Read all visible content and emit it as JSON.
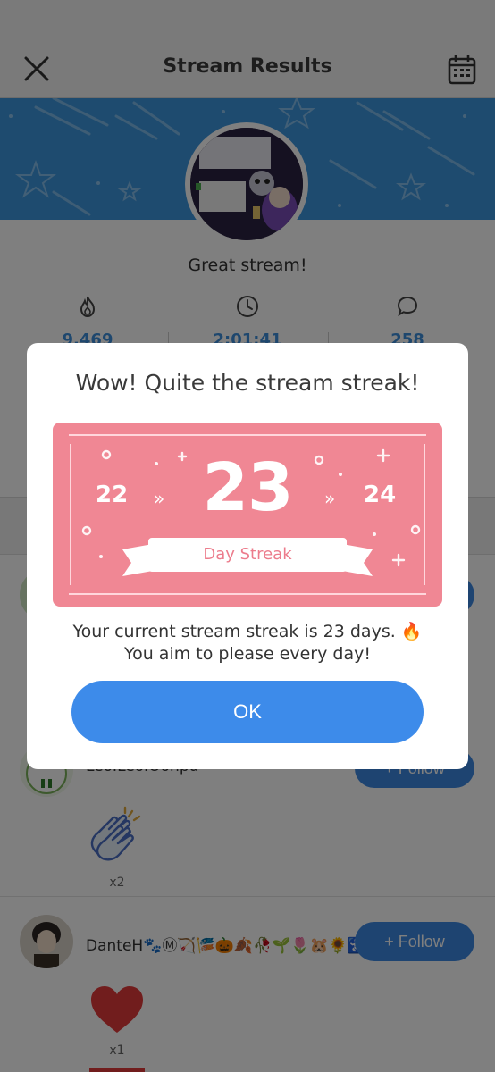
{
  "header": {
    "title": "Stream Results",
    "close_icon": "close-icon",
    "calendar_icon": "calendar-icon"
  },
  "banner": {
    "color": "#3d97de",
    "avatar_texts": [
      "scary sundays",
      "the witches house",
      "lurk ok!",
      "newcomer ok!"
    ]
  },
  "summary": {
    "headline": "Great stream!",
    "stats": [
      {
        "icon": "flame-icon",
        "value": "9,469"
      },
      {
        "icon": "clock-icon",
        "value": "2:01:41"
      },
      {
        "icon": "chat-bubble-icon",
        "value": "258"
      }
    ]
  },
  "supporters": [
    {
      "name": "Leo.Leo.Oonpu",
      "follow_label": "+ Follow",
      "reaction_icon": "clapping-hands-icon",
      "reaction_count": "x2"
    },
    {
      "name": "DanteH🐾Ⓜ🏹🎏🎃🍂🥀🌱🌷🐹🌻🚼�🥔�",
      "follow_label": "+ Follow",
      "reaction_icon": "heart-icon",
      "reaction_count": "x1"
    }
  ],
  "modal": {
    "title": "Wow! Quite the stream streak!",
    "streak": {
      "previous": "22",
      "current": "23",
      "next": "24",
      "label": "Day Streak",
      "card_color": "#f08794"
    },
    "message_line1": "Your current stream streak is 23 days. 🔥",
    "message_line2": "You aim to please every day!",
    "ok_label": "OK",
    "accent_color": "#3d8bea"
  }
}
